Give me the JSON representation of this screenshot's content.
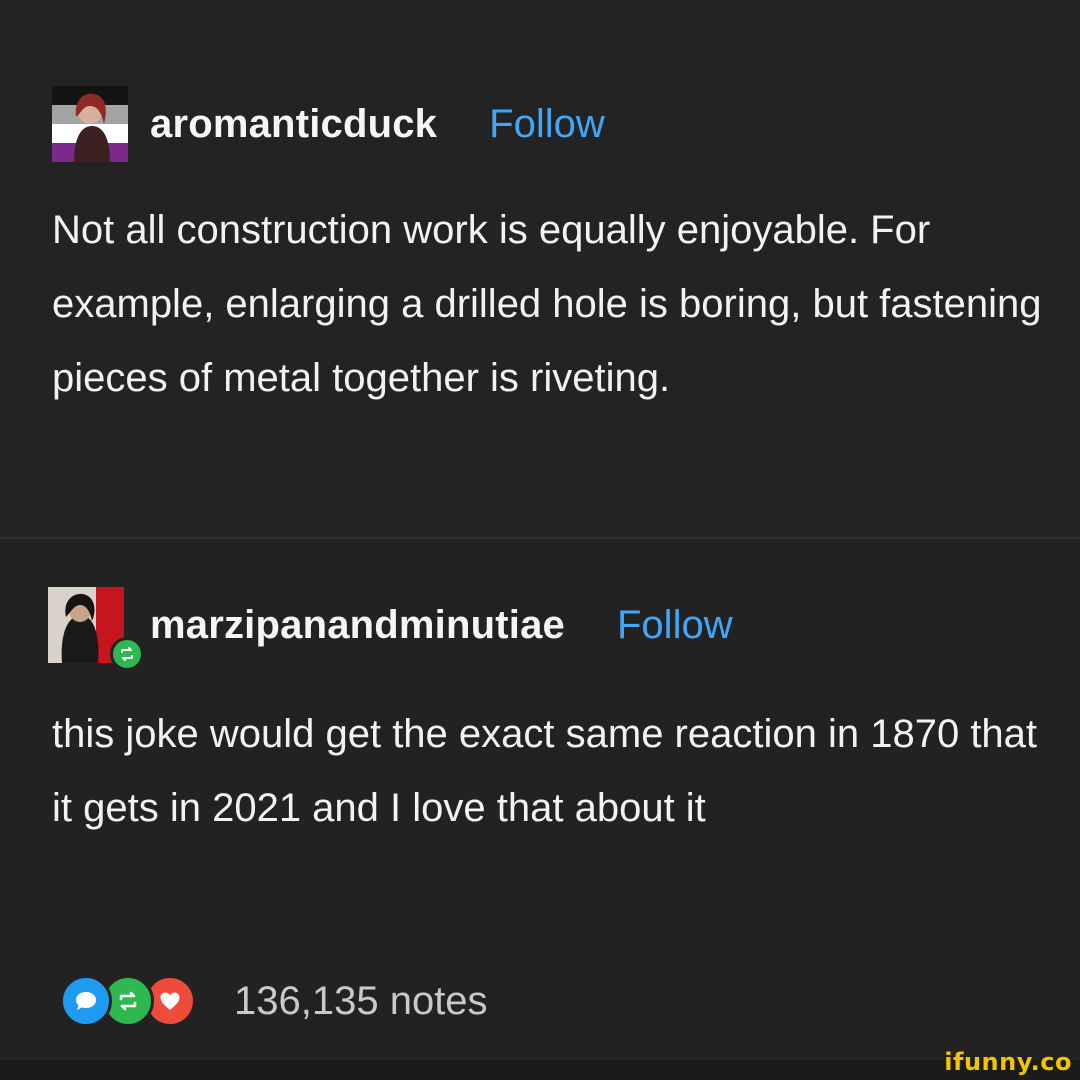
{
  "posts": [
    {
      "username": "aromanticduck",
      "follow_label": "Follow",
      "text": "Not all construction work is equally enjoyable. For example, enlarging a drilled hole is boring, but fastening pieces of metal together is riveting."
    },
    {
      "username": "marzipanandminutiae",
      "follow_label": "Follow",
      "text": "this joke would get the exact same reaction in 1870 that it gets in 2021 and I love that about it",
      "reblog_icon": "reblog-icon"
    }
  ],
  "notes": {
    "count_label": "136,135 notes",
    "icons": [
      "comment-icon",
      "reblog-icon",
      "heart-icon"
    ]
  },
  "watermark": "ifunny.co",
  "colors": {
    "background": "#232323",
    "follow": "#42a5f5",
    "comment": "#1e9bf0",
    "reblog": "#2eb84f",
    "like": "#ef4b3a",
    "watermark": "#f3c400"
  }
}
